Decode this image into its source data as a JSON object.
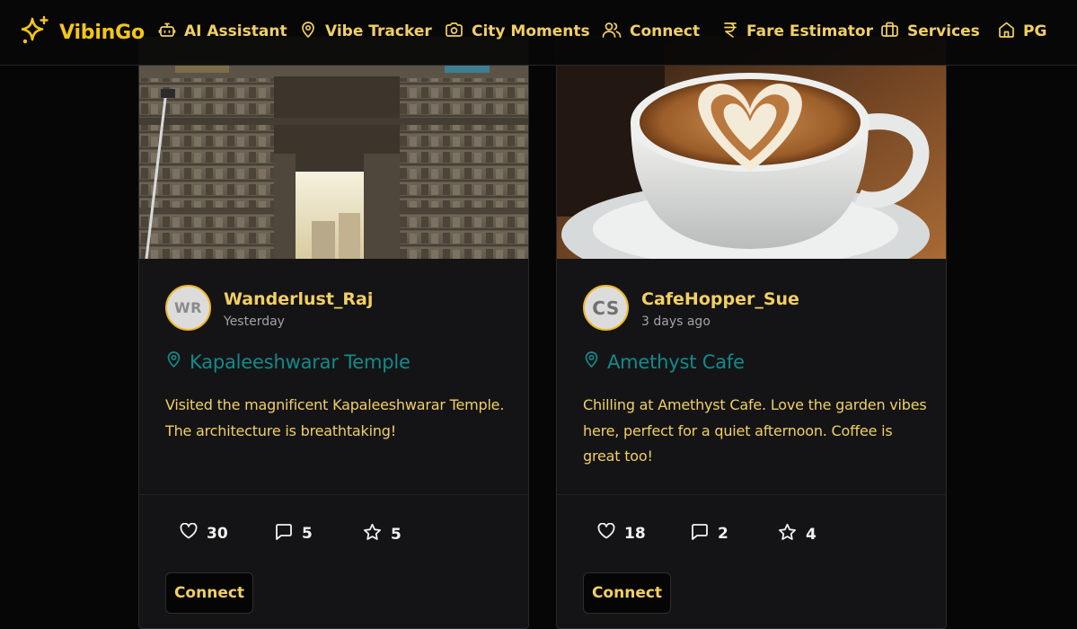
{
  "brand": {
    "name": "VibinGo",
    "icon": "sparkles-icon",
    "color": "#f5c518"
  },
  "nav": {
    "items": [
      {
        "label": "AI Assistant",
        "icon": "robot-icon"
      },
      {
        "label": "Vibe Tracker",
        "icon": "map-pin-icon"
      },
      {
        "label": "City Moments",
        "icon": "camera-icon"
      },
      {
        "label": "Connect",
        "icon": "users-icon"
      },
      {
        "label": "Fare Estimator",
        "icon": "rupee-icon"
      },
      {
        "label": "Services",
        "icon": "briefcase-icon"
      },
      {
        "label": "PG",
        "icon": "home-icon"
      }
    ]
  },
  "posts": [
    {
      "image": "temple-gopuram-photo",
      "avatar_initials": "WR",
      "username": "Wanderlust_Raj",
      "timestamp": "Yesterday",
      "location": "Kapaleeshwarar Temple",
      "description": "Visited the magnificent Kapaleeshwarar Temple. The architecture is breathtaking!",
      "likes": "30",
      "comments": "5",
      "stars": "5",
      "connect_label": "Connect"
    },
    {
      "image": "latte-art-coffee-photo",
      "avatar_initials": "CS",
      "username": "CafeHopper_Sue",
      "timestamp": "3 days ago",
      "location": "Amethyst Cafe",
      "description": "Chilling at Amethyst Cafe. Love the garden vibes here, perfect for a quiet afternoon. Coffee is great too!",
      "likes": "18",
      "comments": "2",
      "stars": "4",
      "connect_label": "Connect"
    }
  ],
  "colors": {
    "background": "#060606",
    "card": "#141416",
    "accent_yellow": "#f2cf63",
    "location_teal": "#138a8a",
    "avatar_border": "#f0b820"
  }
}
